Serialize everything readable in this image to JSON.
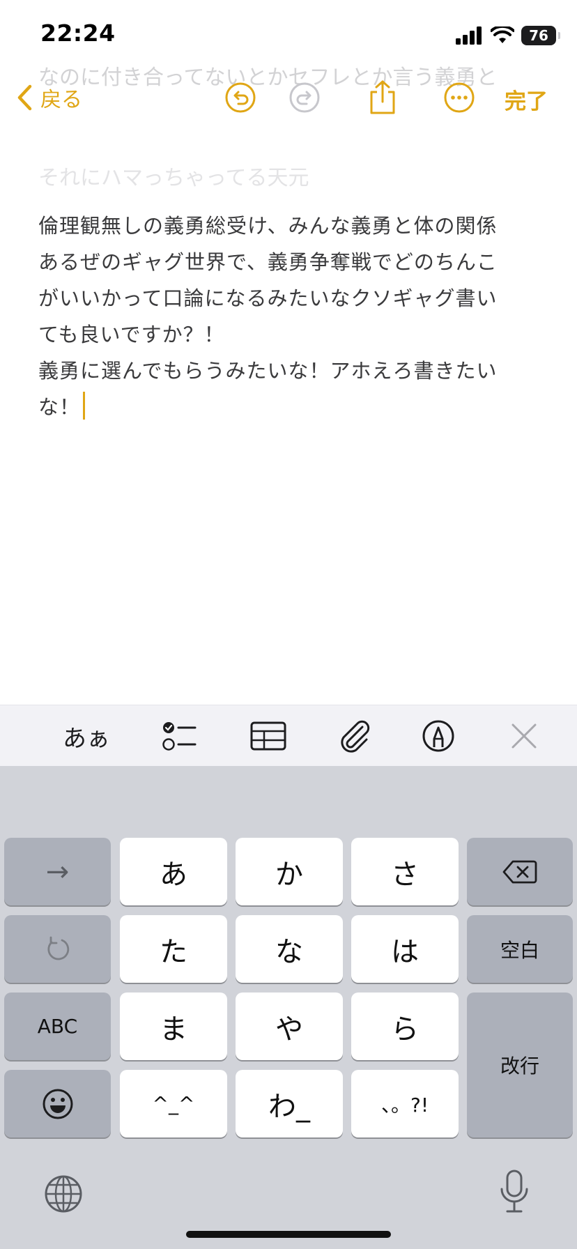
{
  "ghost_text": {
    "line1": "なのに付き合ってないとかセフレとか言う義勇と",
    "line2": "それにハマっちゃってる天元"
  },
  "status_bar": {
    "time": "22:24",
    "battery": "76"
  },
  "toolbar": {
    "back_label": "戻る",
    "done_label": "完了"
  },
  "note": {
    "lines": [
      "倫理観無しの義勇総受け、みんな義勇と体の関係",
      "あるぜのギャグ世界で、義勇争奪戦でどのちんこ",
      "がいいかって口論になるみたいなクソギャグ書い",
      "ても良いですか？！",
      "義勇に選んでもらうみたいな！アホえろ書きたい",
      "な！"
    ]
  },
  "format_bar": {
    "text_style_label": "あぁ"
  },
  "keyboard": {
    "arrow": "→",
    "keys": [
      "あ",
      "か",
      "さ",
      "た",
      "な",
      "は",
      "ま",
      "や",
      "ら",
      "^_^",
      "わ_",
      "、。?!"
    ],
    "space": "空白",
    "abc": "ABC",
    "return": "改行"
  },
  "colors": {
    "accent": "#e0a615",
    "keyboard_bg": "#d1d3d9",
    "dark_key": "#acb0ba"
  }
}
